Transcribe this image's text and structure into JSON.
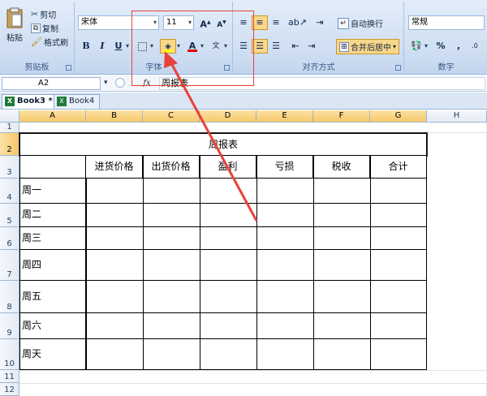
{
  "ribbon": {
    "clipboard": {
      "paste": "粘贴",
      "cut": "剪切",
      "copy": "复制",
      "format_painter": "格式刷",
      "group_label": "剪贴板"
    },
    "font": {
      "font_name": "宋体",
      "font_size": "11",
      "bold": "B",
      "italic": "I",
      "underline": "U",
      "group_label": "字体"
    },
    "alignment": {
      "wrap_text": "自动换行",
      "merge_center": "合并后居中",
      "group_label": "对齐方式"
    },
    "number": {
      "format": "常规",
      "percent": "%",
      "comma": ",",
      "group_label": "数字"
    }
  },
  "formula_bar": {
    "name_box": "A2",
    "fx": "fx",
    "content": "周报表"
  },
  "workbooks": [
    {
      "label": "Book3 *",
      "active": true
    },
    {
      "label": "Book4",
      "active": false
    }
  ],
  "columns": [
    "A",
    "B",
    "C",
    "D",
    "E",
    "F",
    "G",
    "H"
  ],
  "rows": [
    "1",
    "2",
    "3",
    "4",
    "5",
    "6",
    "7",
    "8",
    "9",
    "10",
    "11",
    "12"
  ],
  "table": {
    "title": "周报表",
    "headers": [
      "",
      "进货价格",
      "出货价格",
      "盈利",
      "亏损",
      "税收",
      "合计"
    ],
    "row_labels": [
      "周一",
      "周二",
      "周三",
      "周四",
      "周五",
      "周六",
      "周天"
    ]
  },
  "colors": {
    "ribbon_bg": "#cfdef2",
    "highlight": "#f9d78a",
    "annotation": "#e8413b"
  }
}
